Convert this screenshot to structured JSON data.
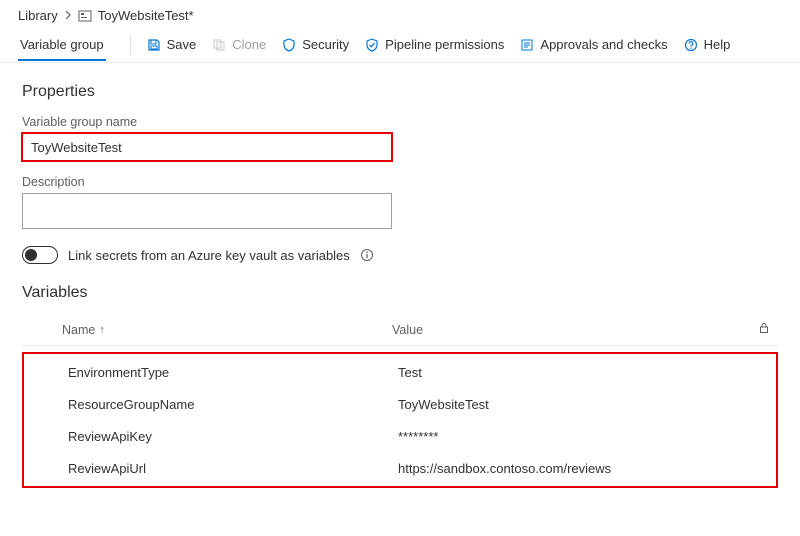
{
  "breadcrumb": {
    "root": "Library",
    "title": "ToyWebsiteTest*"
  },
  "tabs": {
    "variable_group": "Variable group"
  },
  "toolbar": {
    "save": "Save",
    "clone": "Clone",
    "security": "Security",
    "pipeline_permissions": "Pipeline permissions",
    "approvals": "Approvals and checks",
    "help": "Help"
  },
  "properties": {
    "heading": "Properties",
    "name_label": "Variable group name",
    "name_value": "ToyWebsiteTest",
    "desc_label": "Description",
    "desc_value": "",
    "toggle_label": "Link secrets from an Azure key vault as variables"
  },
  "variables": {
    "heading": "Variables",
    "col_name": "Name",
    "col_value": "Value",
    "rows": [
      {
        "name": "EnvironmentType",
        "value": "Test"
      },
      {
        "name": "ResourceGroupName",
        "value": "ToyWebsiteTest"
      },
      {
        "name": "ReviewApiKey",
        "value": "********"
      },
      {
        "name": "ReviewApiUrl",
        "value": "https://sandbox.contoso.com/reviews"
      }
    ]
  }
}
